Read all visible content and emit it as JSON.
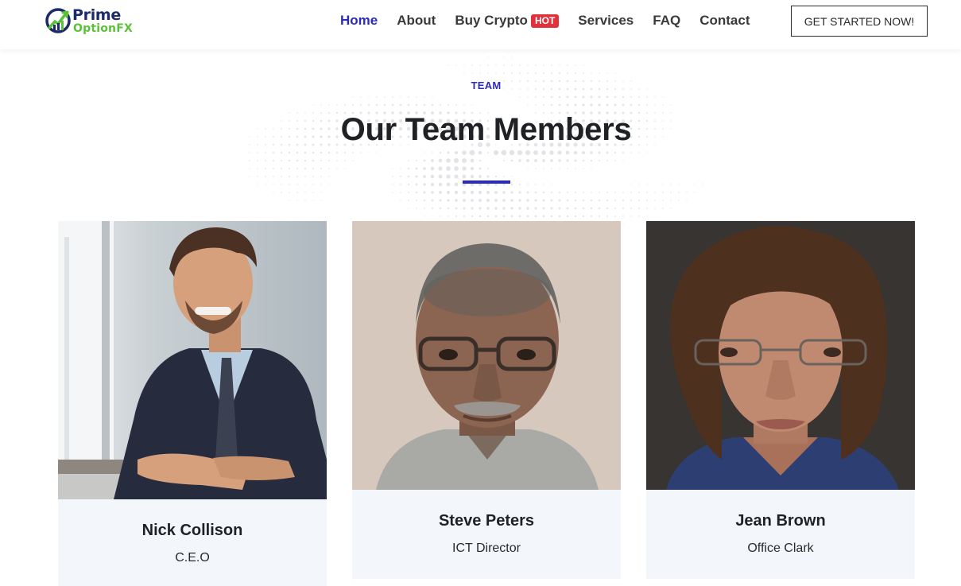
{
  "brand": {
    "line1": "Prime",
    "line2": "OptionFX",
    "primary_color": "#1c2a6b",
    "accent_color": "#5cc13a"
  },
  "nav": {
    "items": [
      {
        "label": "Home",
        "active": true
      },
      {
        "label": "About"
      },
      {
        "label": "Buy Crypto",
        "badge": "HOT"
      },
      {
        "label": "Services"
      },
      {
        "label": "FAQ"
      },
      {
        "label": "Contact"
      }
    ],
    "cta_label": "GET STARTED NOW!"
  },
  "section": {
    "eyebrow": "TEAM",
    "title": "Our Team Members",
    "accent_color": "#2b2bbf"
  },
  "team": [
    {
      "name": "Nick Collison",
      "role": "C.E.O"
    },
    {
      "name": "Steve Peters",
      "role": "ICT Director"
    },
    {
      "name": "Jean Brown",
      "role": "Office Clark"
    }
  ],
  "colors": {
    "hot_badge": "#e0313c",
    "card_background": "#f3f7fb"
  }
}
